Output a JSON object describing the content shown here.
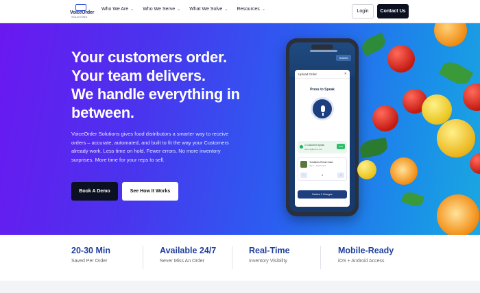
{
  "nav": {
    "logo_text": "VoiceOrder",
    "logo_sub": "SOLUTIONS",
    "menu": [
      {
        "label": "Who We Are"
      },
      {
        "label": "Who We Serve"
      },
      {
        "label": "What We Solve"
      },
      {
        "label": "Resources"
      }
    ],
    "login_label": "Login",
    "contact_label": "Contact Us"
  },
  "hero": {
    "headline": [
      "Your customers order.",
      "Your team delivers.",
      "We handle everything in",
      "between."
    ],
    "subcopy": "VoiceOrder Solutions gives food distributors a smarter way to receive orders – accurate, automated, and built to fit the way your Customers already work. Less time on hold. Fewer errors. No more inventory surprises. More time for your reps to sell.",
    "primary_cta": "Book A Demo",
    "secondary_cta": "See How It Works"
  },
  "phone": {
    "header_pill": "Submit",
    "modal_title": "Upload Order",
    "press_to_speak": "Press to Speak",
    "matched_title": "1 Customer Speak",
    "matched_sub": "Items added to cart",
    "matched_badge": "Add",
    "item_title": "Tomatoes Roma Case",
    "item_sub": "Qty 1 · Confirmed",
    "item_qty": "1",
    "review_label": "Review 1 Changes"
  },
  "stats": [
    {
      "value": "20-30 Min",
      "label": "Saved Per Order"
    },
    {
      "value": "Available 24/7",
      "label": "Never Miss An Order"
    },
    {
      "value": "Real-Time",
      "label": "Inventory Visibility"
    },
    {
      "value": "Mobile-Ready",
      "label": "iOS + Android Access"
    }
  ],
  "colors": {
    "accent": "#1f3f9e",
    "dark": "#0b1120",
    "hero_start": "#6a18f0",
    "hero_end": "#1aa8e0"
  }
}
